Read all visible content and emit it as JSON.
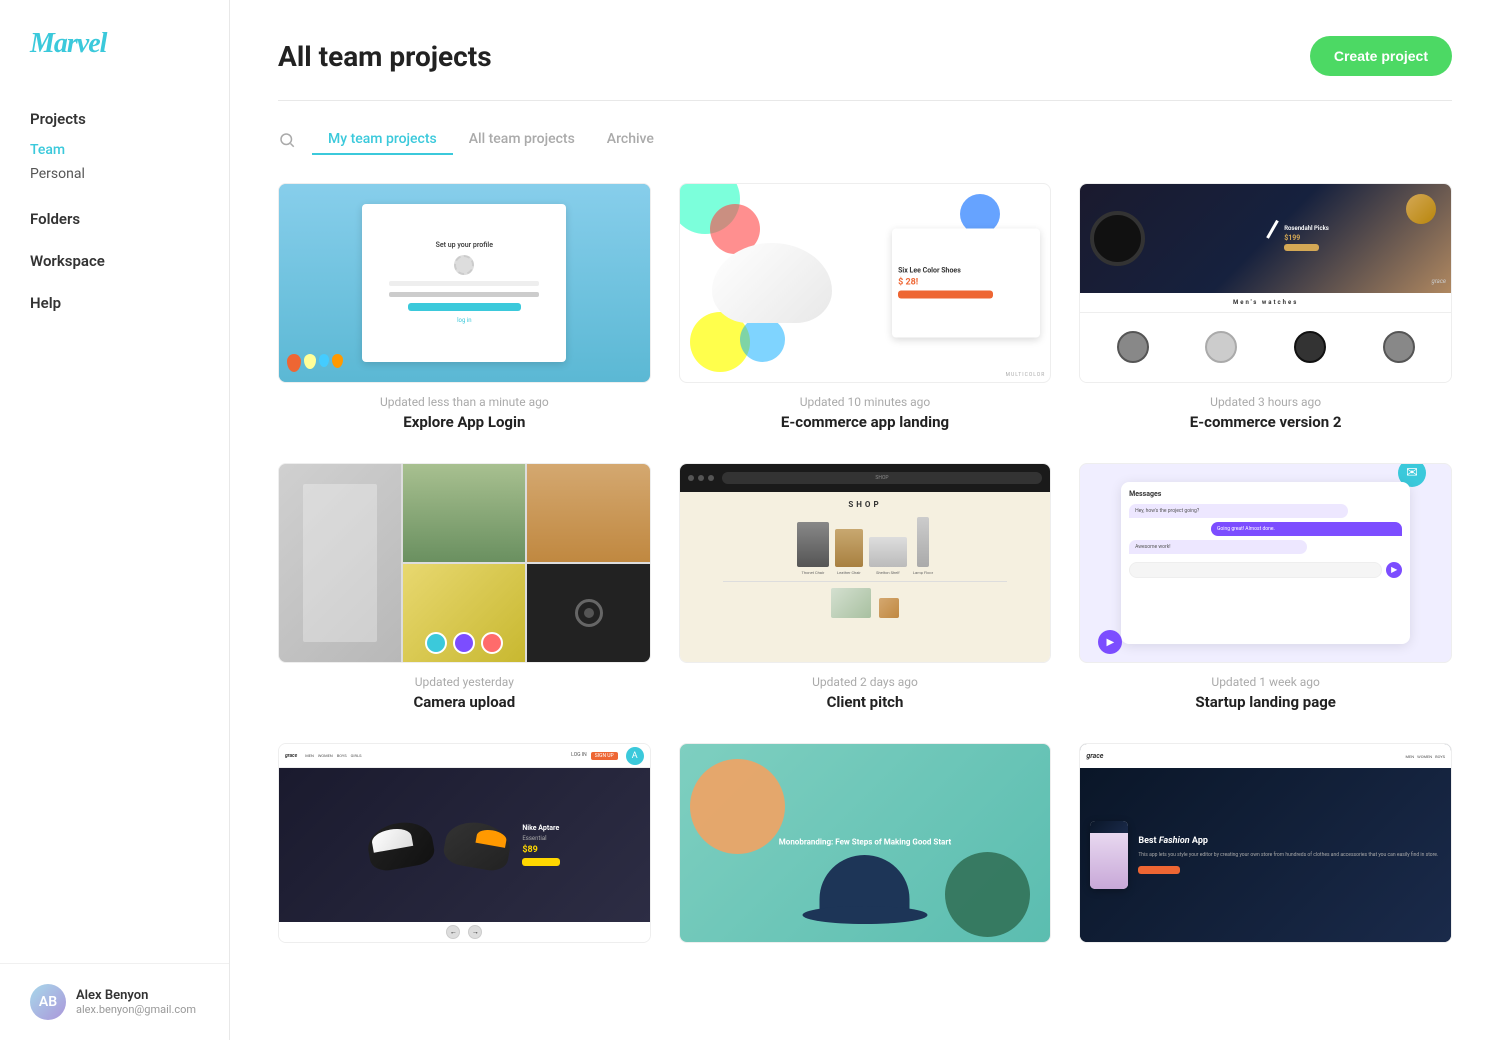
{
  "app": {
    "logo": "Marvel"
  },
  "sidebar": {
    "sections": [
      {
        "label": "Projects",
        "items": [
          {
            "id": "team",
            "label": "Team",
            "active": true
          },
          {
            "id": "personal",
            "label": "Personal",
            "active": false
          }
        ]
      }
    ],
    "links": [
      {
        "id": "folders",
        "label": "Folders"
      },
      {
        "id": "workspace",
        "label": "Workspace"
      },
      {
        "id": "help",
        "label": "Help"
      }
    ]
  },
  "user": {
    "name": "Alex Benyon",
    "email": "alex.benyon@gmail.com",
    "initials": "AB"
  },
  "header": {
    "title": "All team projects",
    "create_button": "Create project"
  },
  "tabs": [
    {
      "id": "my-team",
      "label": "My team projects",
      "active": true
    },
    {
      "id": "all-team",
      "label": "All team projects",
      "active": false
    },
    {
      "id": "archive",
      "label": "Archive",
      "active": false
    }
  ],
  "projects": [
    {
      "id": "explore-app-login",
      "name": "Explore App Login",
      "updated": "Updated less than a minute ago",
      "thumbnail_type": "explore"
    },
    {
      "id": "ecommerce-app-landing",
      "name": "E-commerce app landing",
      "updated": "Updated 10 minutes ago",
      "thumbnail_type": "ecommerce"
    },
    {
      "id": "ecommerce-version-2",
      "name": "E-commerce version 2",
      "updated": "Updated 3 hours ago",
      "thumbnail_type": "watches"
    },
    {
      "id": "camera-upload",
      "name": "Camera upload",
      "updated": "Updated yesterday",
      "thumbnail_type": "collage"
    },
    {
      "id": "client-pitch",
      "name": "Client pitch",
      "updated": "Updated 2 days ago",
      "thumbnail_type": "shop"
    },
    {
      "id": "startup-landing-page",
      "name": "Startup landing page",
      "updated": "Updated 1 week ago",
      "thumbnail_type": "messages"
    },
    {
      "id": "nike-shoes",
      "name": "Nike Aptare Essential",
      "updated": "",
      "thumbnail_type": "shoes2"
    },
    {
      "id": "monobranding",
      "name": "Monobranding: Few Steps of Making Good Start",
      "updated": "",
      "thumbnail_type": "mono"
    },
    {
      "id": "fashion-app",
      "name": "Best Fashion App",
      "updated": "",
      "thumbnail_type": "fashion"
    }
  ]
}
